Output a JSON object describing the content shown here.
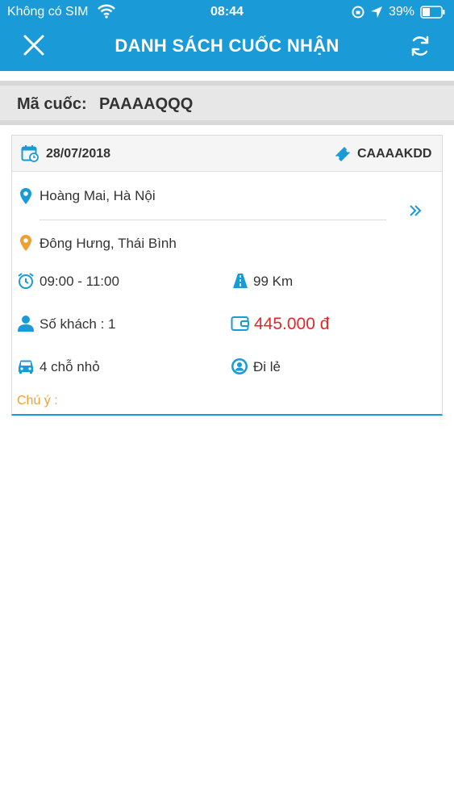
{
  "status_bar": {
    "carrier": "Không có SIM",
    "time": "08:44",
    "battery": "39%"
  },
  "header": {
    "title": "DANH SÁCH CUỐC NHẬN"
  },
  "code_bar": {
    "label": "Mã cuốc:",
    "value": "PAAAAQQQ"
  },
  "card": {
    "date": "28/07/2018",
    "ticket_code": "CAAAAKDD",
    "pickup": "Hoàng Mai, Hà Nội",
    "dropoff": "Đông Hưng, Thái Bình",
    "time_range": "09:00 - 11:00",
    "distance": "99 Km",
    "passengers": "Số khách : 1",
    "price": "445.000 đ",
    "car_type": "4 chỗ nhỏ",
    "trip_type": "Đi lẻ",
    "note_label": "Chú ý :"
  },
  "colors": {
    "brand": "#1a9ad6",
    "price": "#e02a2a",
    "note": "#f0a030",
    "origin_pin": "#1a9ad6",
    "destination_pin": "#f0a030"
  }
}
